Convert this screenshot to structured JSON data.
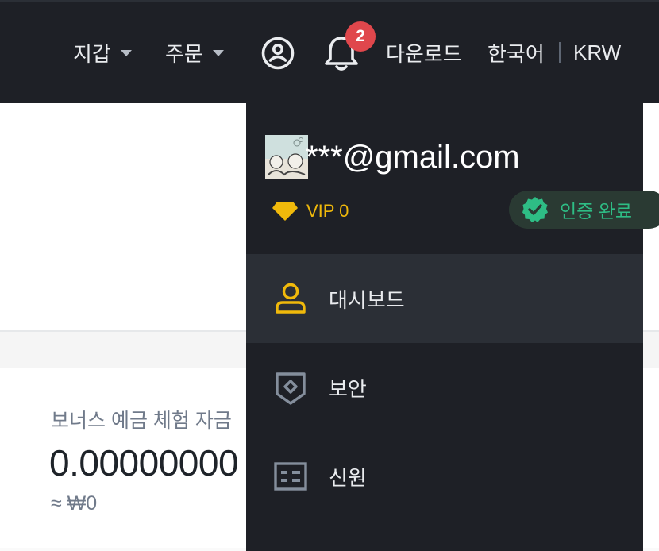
{
  "topbar": {
    "wallet_label": "지갑",
    "orders_label": "주문",
    "notification_count": "2",
    "download_label": "다운로드",
    "language_label": "한국어",
    "currency_label": "KRW"
  },
  "account_menu": {
    "email": "***@gmail.com",
    "vip_label": "VIP 0",
    "verified_label": "인증 완료",
    "items": [
      {
        "label": "대시보드",
        "icon": "user-icon",
        "active": true
      },
      {
        "label": "보안",
        "icon": "shield-icon",
        "active": false
      },
      {
        "label": "신원",
        "icon": "id-card-icon",
        "active": false
      }
    ]
  },
  "bonus": {
    "label": "보너스 예금 체험 자금",
    "value": "0.00000000",
    "approx": "≈ ₩0"
  },
  "colors": {
    "header_bg": "#1e2026",
    "accent_yellow": "#f0b90b",
    "verified_green": "#2ebd85",
    "badge_red": "#e0474c"
  }
}
